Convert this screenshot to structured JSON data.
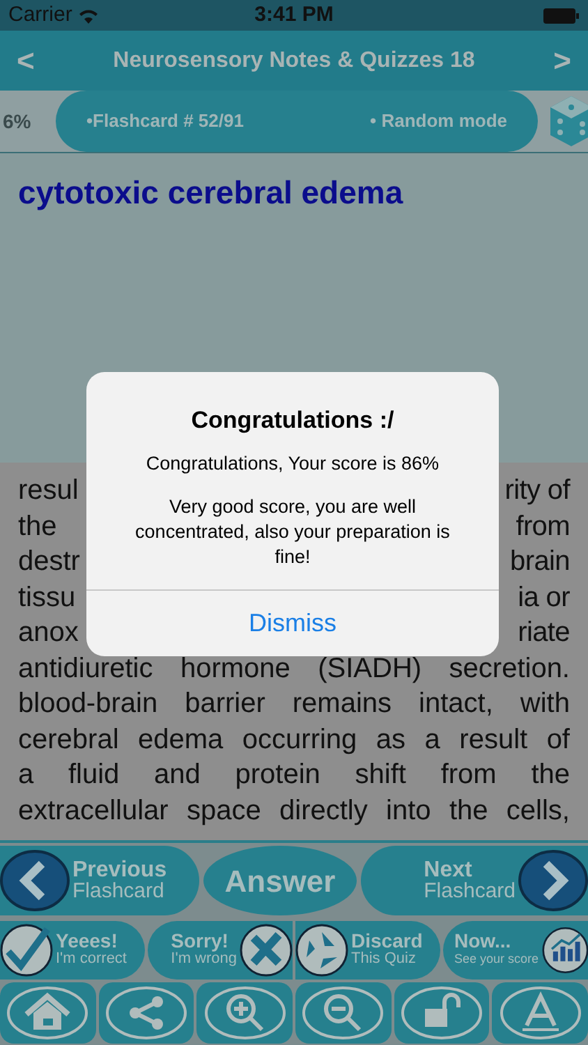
{
  "status_bar": {
    "carrier": "Carrier",
    "time": "3:41 PM"
  },
  "nav": {
    "back": "<",
    "title": "Neurosensory Notes & Quizzes 18",
    "forward": ">"
  },
  "info_bar": {
    "score": "6%",
    "flashcard": "•Flashcard #  52/91",
    "mode": "• Random mode"
  },
  "term": "cytotoxic cerebral edema",
  "body_lines": [
    {
      "kind": "split",
      "left": "resul",
      "right": "rity of"
    },
    {
      "kind": "split",
      "left": "the",
      "right": "from"
    },
    {
      "kind": "split",
      "left": "destr",
      "right": "brain"
    },
    {
      "kind": "split",
      "left": "tissu",
      "right": "ia or"
    },
    {
      "kind": "split",
      "left": "anox",
      "right": "riate"
    },
    {
      "kind": "full",
      "text": "antidiuretic hormone (SIADH) secretion."
    },
    {
      "kind": "full",
      "text": "blood-brain barrier remains intact, with"
    },
    {
      "kind": "full",
      "text": "cerebral edema occurring as a result of"
    },
    {
      "kind": "full",
      "text": "a fluid and protein shift from the"
    },
    {
      "kind": "full",
      "text": "extracellular space directly into the cells,"
    }
  ],
  "alert": {
    "title": "Congratulations :/",
    "message_1": "Congratulations, Your score is 86%",
    "message_2": "Very good score, you are well concentrated, also your preparation is fine!",
    "button": "Dismiss"
  },
  "nav_buttons": [
    {
      "kind": "prev",
      "line_1": "Previous",
      "line_2": "Flashcard"
    },
    {
      "kind": "answer",
      "label": "Answer"
    },
    {
      "kind": "next",
      "line_1": "Next",
      "line_2": "Flashcard"
    }
  ],
  "action_buttons": [
    {
      "kind": "correct",
      "line_1": "Yeees!",
      "line_2": "I'm correct"
    },
    {
      "kind": "wrong",
      "line_1": "Sorry!",
      "line_2": "I'm wrong"
    },
    {
      "kind": "discard",
      "line_1": "Discard",
      "line_2": "This Quiz"
    },
    {
      "kind": "score",
      "line_1": "Now...",
      "line_2": "See your score"
    }
  ],
  "toolbar": [
    {
      "kind": "home"
    },
    {
      "kind": "share"
    },
    {
      "kind": "zoom_in"
    },
    {
      "kind": "zoom_out"
    },
    {
      "kind": "unlock"
    },
    {
      "kind": "font"
    }
  ]
}
